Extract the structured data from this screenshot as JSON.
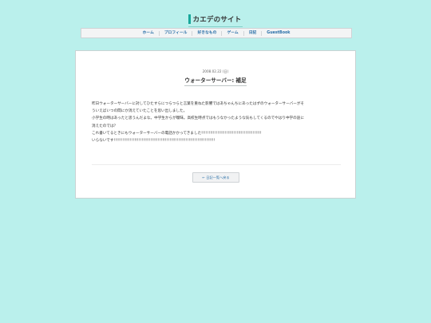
{
  "site": {
    "title": "カエデのサイト"
  },
  "nav": {
    "items": [
      {
        "label": "ホーム"
      },
      {
        "label": "プロフィール"
      },
      {
        "label": "好きなもの"
      },
      {
        "label": "ゲーム"
      },
      {
        "label": "日記"
      },
      {
        "label": "GuestBook"
      }
    ]
  },
  "post": {
    "date": "2008.02.22 (日)",
    "title": "ウォーターサーバー: 補足",
    "lines": [
      "昨日ウォーターサーバーに対してひたすらにつらつらと言葉を重ねた影響ではあちゃんちにあったはずのウォーターサーバーがそ",
      "ういえばいつの間にか消えていたことを思い出しました。",
      "小学生の時はあったと思うんだよな。中学生からが曖昧。高校生時点ではもうなかったような気もしてくるのでやはり中学の途に",
      "消えたのでは？",
      "これ書いてるときにもウォーターサーバーの電話かかってきました!!!!!!!!!!!!!!!!!!!!!!!!!!!!!!!!!!!!!!!!!",
      "いらないです!!!!!!!!!!!!!!!!!!!!!!!!!!!!!!!!!!!!!!!!!!!!!!!!!!!!!!!!!!!!!!!!!!!!!"
    ]
  },
  "back_button": {
    "label": "← 日記一覧へ戻る"
  }
}
